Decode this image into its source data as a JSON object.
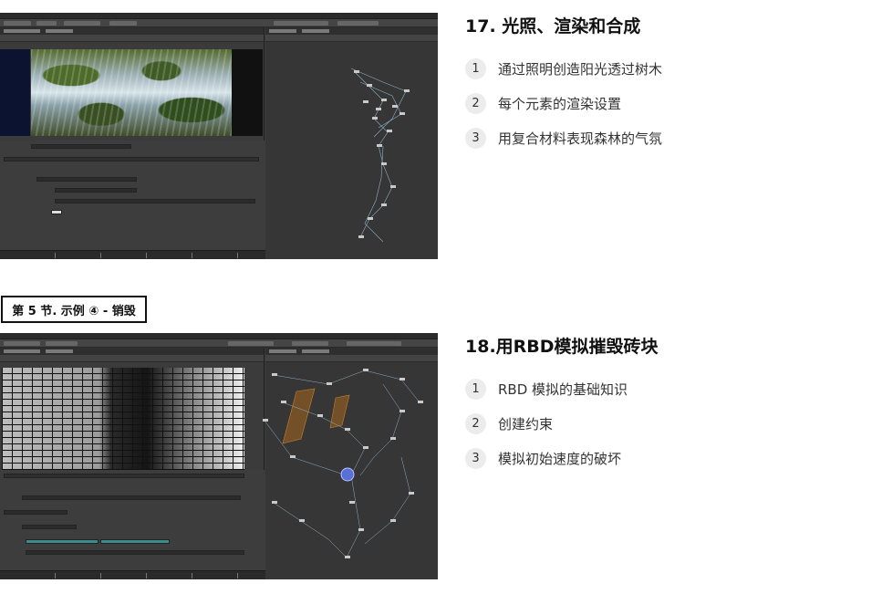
{
  "section_tag": "第 5 节. 示例 ④ - 销毁",
  "lessons": [
    {
      "title": "17. 光照、渲染和合成",
      "items": [
        {
          "number": "1",
          "text": "通过照明创造阳光透过树木"
        },
        {
          "number": "2",
          "text": "每个元素的渲染设置"
        },
        {
          "number": "3",
          "text": "用复合材料表现森林的气氛"
        }
      ]
    },
    {
      "title": "18.用RBD模拟摧毁砖块",
      "items": [
        {
          "number": "1",
          "text": "RBD 模拟的基础知识"
        },
        {
          "number": "2",
          "text": "创建约束"
        },
        {
          "number": "3",
          "text": "模拟初始速度的破坏"
        }
      ]
    }
  ]
}
